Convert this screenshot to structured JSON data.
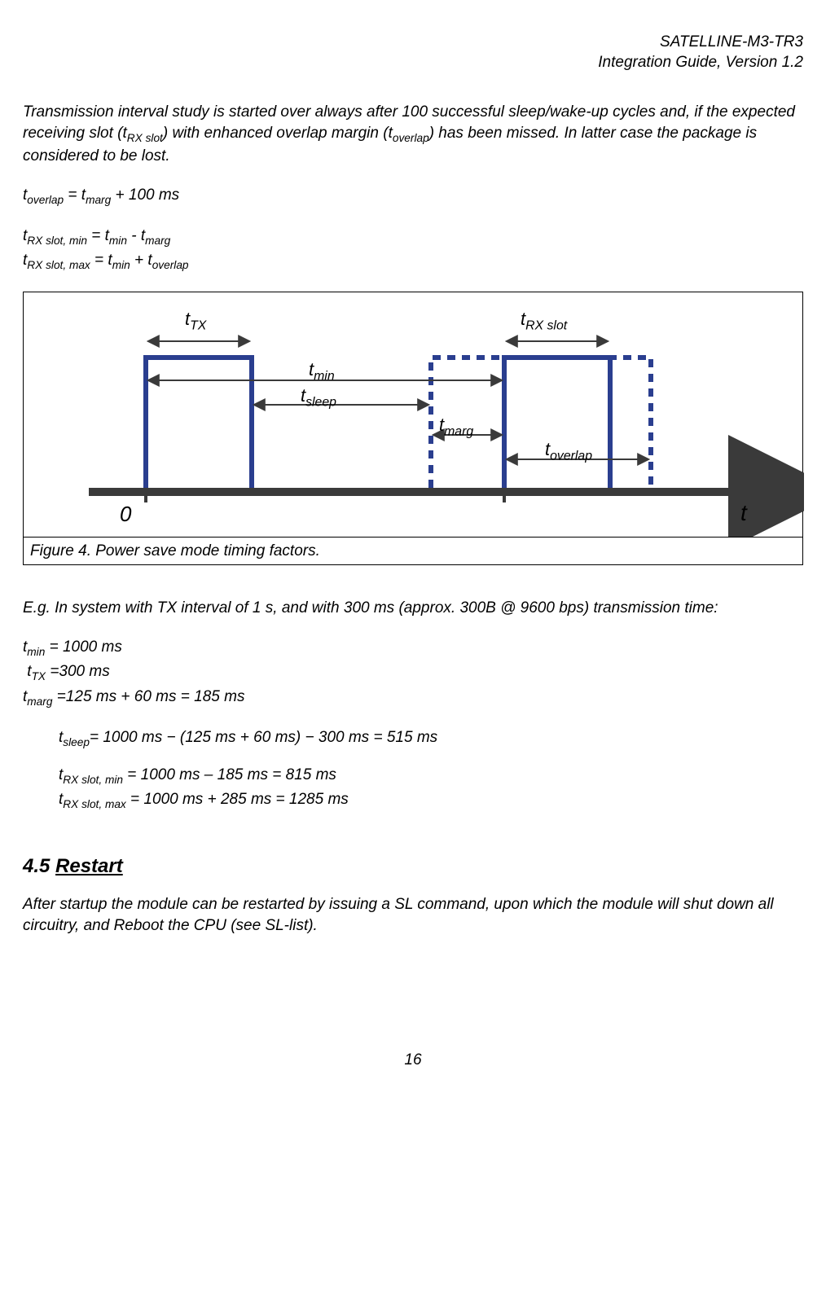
{
  "header": {
    "line1": "SATELLINE-M3-TR3",
    "line2": "Integration Guide, Version 1.2"
  },
  "intro": {
    "p1a": "Transmission interval study is started over always after 100 successful sleep/wake-up cycles and, if the expected receiving slot (",
    "p1b": ") with enhanced overlap margin (",
    "p1c": ") has been missed. In latter case the package is considered to be lost.",
    "sub1": "RX slot",
    "sub2": "overlap"
  },
  "eq1": {
    "lhs_sub": "overlap",
    "rhs_sub": "marg",
    "tail": " + 100 ms"
  },
  "eq2": {
    "lhs_sub": "RX slot, min",
    "a_sub": "min",
    "b_sub": "marg",
    "op": " - "
  },
  "eq3": {
    "lhs_sub": "RX slot, max",
    "a_sub": "min",
    "b_sub": "overlap",
    "op": " + "
  },
  "figure": {
    "caption": "Figure 4.  Power save mode timing factors.",
    "labels": {
      "t_tx": "TX",
      "t_rx": "RX slot",
      "t_min": "min",
      "t_sleep": "sleep",
      "t_marg": "marg",
      "t_overlap": "overlap",
      "zero": "0",
      "t": "t"
    }
  },
  "example": {
    "lead": "E.g. In system with TX interval of 1 s, and with 300 ms (approx. 300B @ 9600 bps) transmission time:",
    "l1_sub": "min",
    "l1_val": " = 1000 ms",
    "l2_sub": "TX",
    "l2_val": " =300 ms",
    "l3_sub": "marg",
    "l3_val": " =125 ms + 60 ms = 185 ms",
    "c1_sub": "sleep",
    "c1_val": "= 1000 ms − (125 ms + 60 ms) − 300 ms = 515 ms",
    "c2_sub": "RX slot, min",
    "c2_val": " = 1000 ms – 185 ms = 815 ms",
    "c3_sub": "RX slot, max",
    "c3_val": " = 1000 ms + 285 ms = 1285 ms"
  },
  "section": {
    "num": "4.5 ",
    "title": "Restart"
  },
  "restart_para": "After startup the module can be restarted by issuing a SL command, upon which the module will shut down all circuitry, and Reboot the CPU (see SL-list).",
  "page_number": "16"
}
